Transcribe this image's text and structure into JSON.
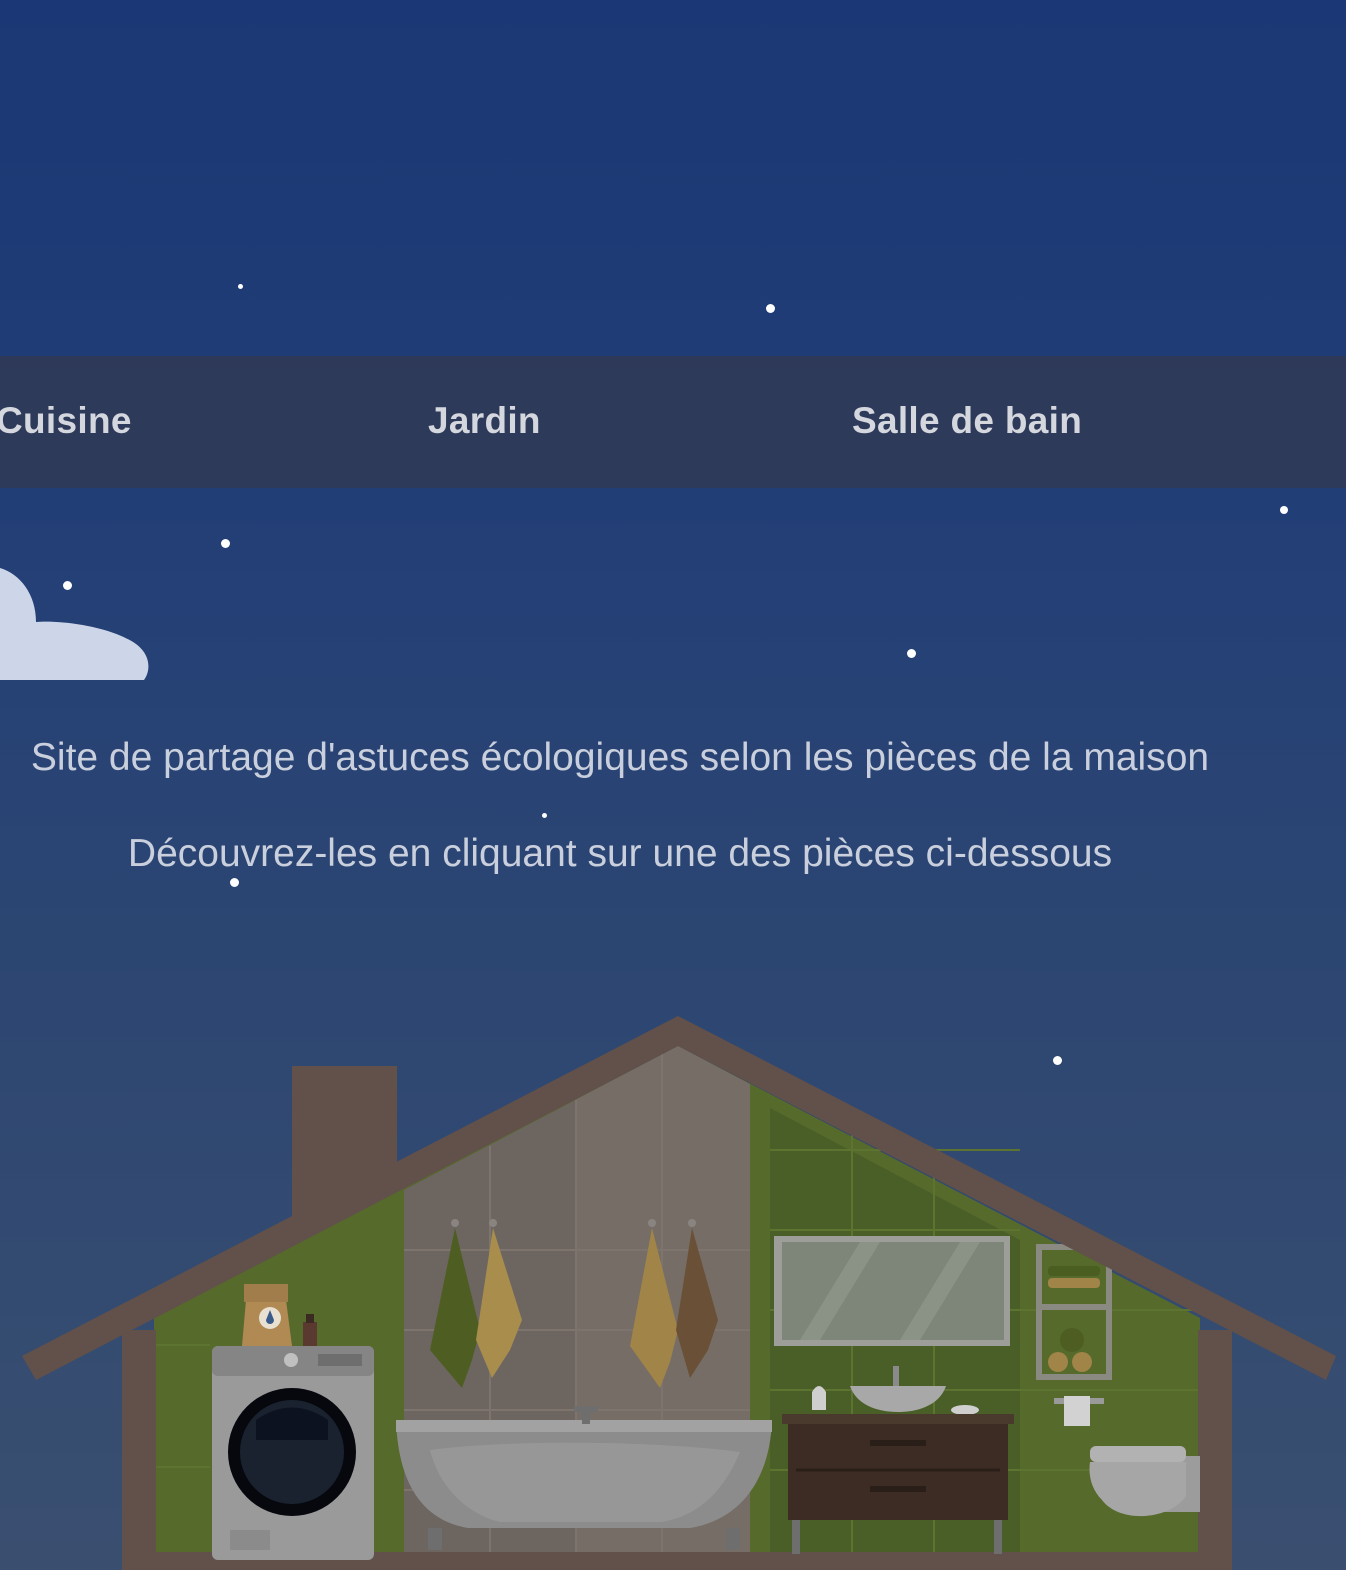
{
  "nav": {
    "items": [
      {
        "label": "Cuisine"
      },
      {
        "label": "Jardin"
      },
      {
        "label": "Salle de bain"
      }
    ]
  },
  "hero": {
    "tagline": "Site de partage d'astuces écologiques selon les pièces de la maison",
    "cta": "Découvrez-les en cliquant sur une des pièces ci-dessous"
  },
  "colors": {
    "sky_top": "#1b3775",
    "sky_bottom": "#3a4f70",
    "navbar": "#303a58",
    "nav_text": "#d4d7de",
    "roof": "#62504a",
    "wall_green": "#566a2c"
  },
  "icons": [
    "star-icon",
    "cloud-icon",
    "house-illustration"
  ]
}
